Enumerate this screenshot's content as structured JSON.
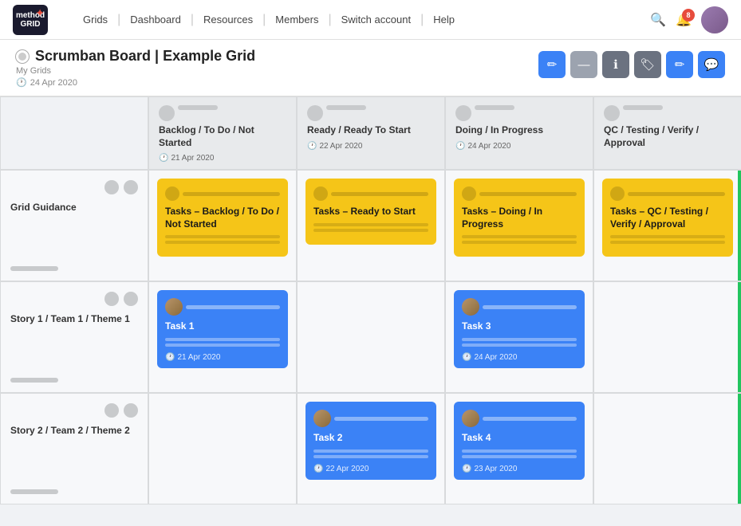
{
  "app": {
    "logo_line1": "method",
    "logo_line2": "GRID"
  },
  "nav": {
    "links": [
      "Grids",
      "Dashboard",
      "Resources",
      "Members",
      "Switch account",
      "Help"
    ],
    "notification_count": "8"
  },
  "page": {
    "title": "Scrumban Board | Example Grid",
    "breadcrumb": "My Grids",
    "date": "24 Apr 2020"
  },
  "toolbar": {
    "btn1": "✏",
    "btn2": "—",
    "btn3": "ℹ",
    "btn4": "🏷",
    "btn5": "✏",
    "btn6": "💬"
  },
  "columns": [
    {
      "label": "",
      "date": ""
    },
    {
      "label": "Backlog / To Do / Not Started",
      "date": "21 Apr 2020"
    },
    {
      "label": "Ready / Ready To Start",
      "date": "22 Apr 2020"
    },
    {
      "label": "Doing / In Progress",
      "date": "24 Apr 2020"
    },
    {
      "label": "QC / Testing / Verify / Approval",
      "date": ""
    }
  ],
  "rows": [
    {
      "label": "Grid Guidance",
      "cells": [
        {
          "type": "yellow",
          "title": "Tasks – Backlog / To Do / Not Started",
          "has_card": true
        },
        {
          "type": "yellow",
          "title": "Tasks – Ready to Start",
          "has_card": true
        },
        {
          "type": "yellow",
          "title": "Tasks – Doing / In Progress",
          "has_card": true
        },
        {
          "type": "yellow",
          "title": "Tasks – QC / Testing / Verify / Approval",
          "has_card": true,
          "accent": true
        }
      ]
    },
    {
      "label": "Story 1 / Team 1 / Theme 1",
      "cells": [
        {
          "type": "blue",
          "title": "Task 1",
          "date": "21 Apr 2020",
          "has_card": true
        },
        {
          "type": "empty",
          "has_card": false
        },
        {
          "type": "blue",
          "title": "Task 3",
          "date": "24 Apr 2020",
          "has_card": true
        },
        {
          "type": "empty",
          "has_card": false,
          "accent": true
        }
      ]
    },
    {
      "label": "Story 2 / Team 2 / Theme 2",
      "cells": [
        {
          "type": "empty",
          "has_card": false
        },
        {
          "type": "blue",
          "title": "Task 2",
          "date": "22 Apr 2020",
          "has_card": true
        },
        {
          "type": "blue",
          "title": "Task 4",
          "date": "23 Apr 2020",
          "has_card": true
        },
        {
          "type": "empty",
          "has_card": false,
          "accent": true
        }
      ]
    }
  ]
}
